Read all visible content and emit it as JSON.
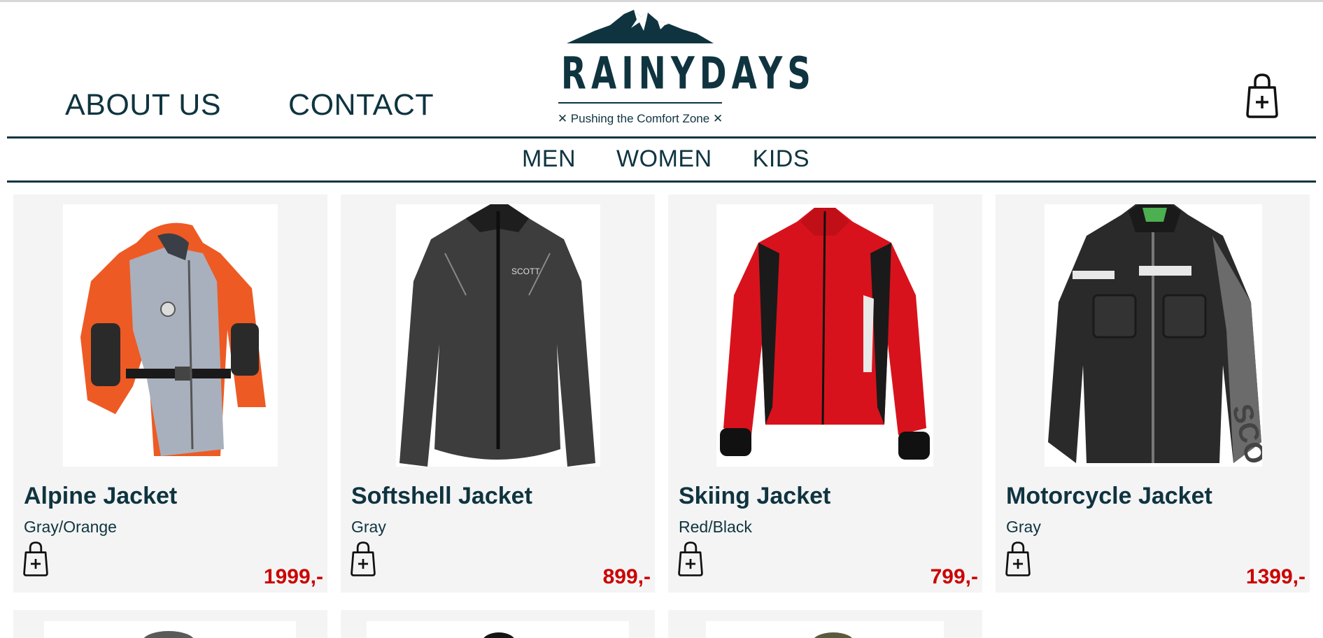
{
  "header": {
    "nav_left": [
      "ABOUT US",
      "CONTACT"
    ],
    "logo_text": "RAINYDAYS",
    "tagline": "✕ Pushing the Comfort Zone ✕",
    "cart_icon": "shopping-bag-plus-icon"
  },
  "categories": [
    "MEN",
    "WOMEN",
    "KIDS"
  ],
  "products": [
    {
      "name": "Alpine Jacket",
      "color": "Gray/Orange",
      "price": "1999,-",
      "icon": "shopping-bag-plus-icon"
    },
    {
      "name": "Softshell Jacket",
      "color": "Gray",
      "price": "899,-",
      "icon": "shopping-bag-plus-icon"
    },
    {
      "name": "Skiing Jacket",
      "color": "Red/Black",
      "price": "799,-",
      "icon": "shopping-bag-plus-icon"
    },
    {
      "name": "Motorcycle Jacket",
      "color": "Gray",
      "price": "1399,-",
      "icon": "shopping-bag-plus-icon"
    }
  ],
  "colors": {
    "brand": "#0f3440",
    "price": "#cc0000",
    "card_bg": "#f4f4f4"
  }
}
